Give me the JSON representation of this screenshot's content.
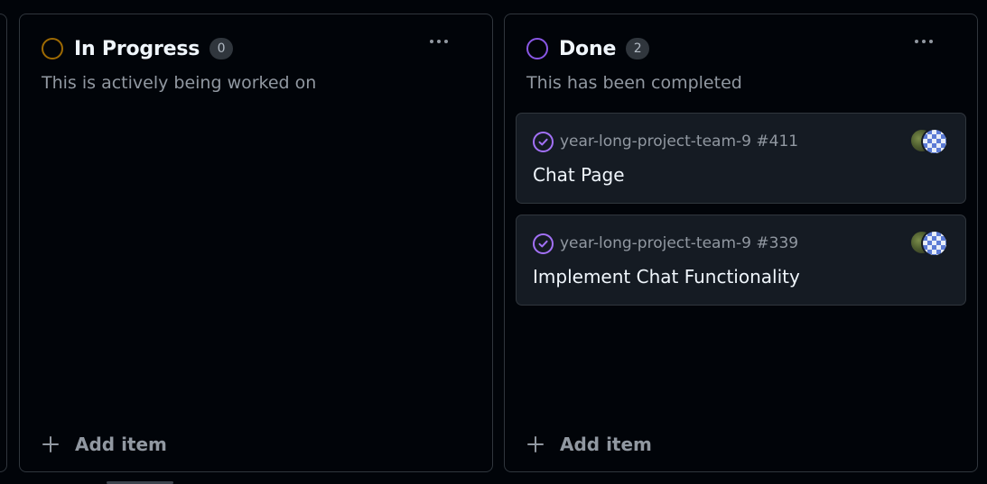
{
  "columns": [
    {
      "title": "In Progress",
      "count": "0",
      "description": "This is actively being worked on",
      "status_color": "#9e6a03",
      "add_label": "Add item",
      "cards": []
    },
    {
      "title": "Done",
      "count": "2",
      "description": "This has been completed",
      "status_color": "#8957e5",
      "add_label": "Add item",
      "cards": [
        {
          "repo": "year-long-project-team-9 #411",
          "title": "Chat Page",
          "icon": "check-circle-icon"
        },
        {
          "repo": "year-long-project-team-9 #339",
          "title": "Implement Chat Functionality",
          "icon": "check-circle-icon"
        }
      ]
    }
  ],
  "icons": {
    "more": "kebab-horizontal-icon",
    "add": "plus-icon",
    "status_in_progress": "circle-outline-icon",
    "status_done": "circle-outline-icon"
  },
  "colors": {
    "background": "#010409",
    "card": "#151b23",
    "border": "#30363d",
    "muted_text": "#9198a1",
    "done_accent": "#a371f7"
  }
}
